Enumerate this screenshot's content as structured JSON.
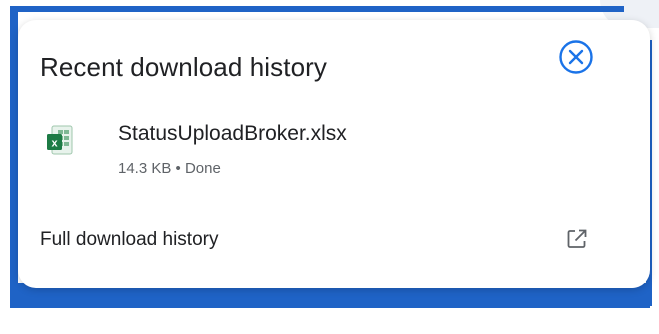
{
  "panel": {
    "title": "Recent download history",
    "close_icon": "close-circle-icon"
  },
  "downloads": [
    {
      "file_name": "StatusUploadBroker.xlsx",
      "meta": "14.3 KB • Done",
      "icon": "excel-file-icon"
    }
  ],
  "footer": {
    "full_history_label": "Full download history",
    "open_icon": "open-in-new-icon"
  },
  "colors": {
    "accent": "#1a73e8",
    "frame": "#1f63c6",
    "excel_green": "#1d7b45"
  }
}
